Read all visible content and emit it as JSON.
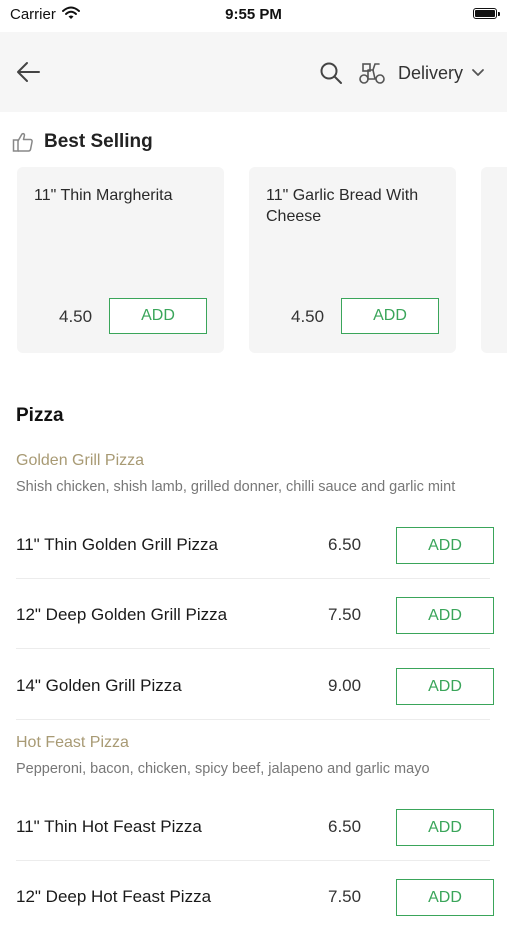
{
  "status_bar": {
    "carrier": "Carrier",
    "time": "9:55 PM"
  },
  "nav": {
    "back_icon": "back-arrow-icon",
    "search_icon": "search-icon",
    "delivery_icon": "scooter-icon",
    "delivery_label": "Delivery"
  },
  "best_selling": {
    "title": "Best Selling",
    "items": [
      {
        "name": "11\" Thin Margherita",
        "price": "4.50",
        "add_label": "ADD"
      },
      {
        "name": "11\" Garlic Bread With Cheese",
        "price": "4.50",
        "add_label": "ADD"
      }
    ]
  },
  "menu": {
    "section_title": "Pizza",
    "groups": [
      {
        "name": "Golden Grill Pizza",
        "description": "Shish chicken, shish lamb, grilled donner, chilli sauce and garlic mint",
        "items": [
          {
            "name": "11\" Thin Golden Grill Pizza",
            "price": "6.50",
            "add_label": "ADD"
          },
          {
            "name": "12\" Deep Golden Grill Pizza",
            "price": "7.50",
            "add_label": "ADD"
          },
          {
            "name": "14\" Golden Grill Pizza",
            "price": "9.00",
            "add_label": "ADD"
          }
        ]
      },
      {
        "name": "Hot Feast Pizza",
        "description": "Pepperoni, bacon, chicken, spicy beef, jalapeno and garlic mayo",
        "items": [
          {
            "name": "11\" Thin Hot Feast Pizza",
            "price": "6.50",
            "add_label": "ADD"
          },
          {
            "name": "12\" Deep Hot Feast Pizza",
            "price": "7.50",
            "add_label": "ADD"
          }
        ]
      }
    ]
  },
  "colors": {
    "accent_green": "#3aa55a",
    "group_name": "#a89a74",
    "nav_bg": "#f6f6f6"
  }
}
